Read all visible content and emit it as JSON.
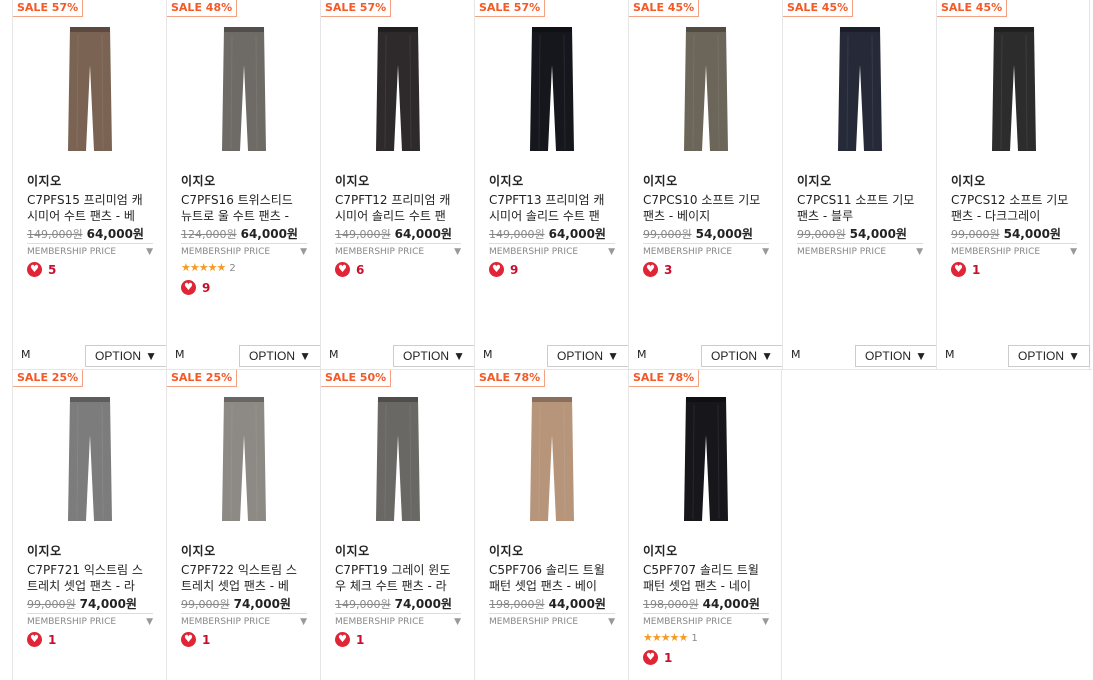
{
  "products_row1": [
    {
      "sale": "SALE 57%",
      "brand": "이지오",
      "name": "C7PFS15 프리미엄 캐시미어 수트 팬츠 - 베",
      "orig": "149,000원",
      "price": "64,000원",
      "membership": "MEMBERSHIP PRICE",
      "likes": "5",
      "stars": "",
      "star_count": "",
      "size": "M",
      "option": "OPTION",
      "color": "#7a6352"
    },
    {
      "sale": "SALE 48%",
      "brand": "이지오",
      "name": "C7PFS16 트위스티드 뉴트로 울 수트 팬츠 -",
      "orig": "124,000원",
      "price": "64,000원",
      "membership": "MEMBERSHIP PRICE",
      "likes": "9",
      "stars": "★★★★★",
      "star_count": "2",
      "size": "M",
      "option": "OPTION",
      "color": "#6e6a66"
    },
    {
      "sale": "SALE 57%",
      "brand": "이지오",
      "name": "C7PFT12 프리미엄 캐시미어 솔리드 수트 팬",
      "orig": "149,000원",
      "price": "64,000원",
      "membership": "MEMBERSHIP PRICE",
      "likes": "6",
      "stars": "",
      "star_count": "",
      "size": "M",
      "option": "OPTION",
      "color": "#2e2a2b"
    },
    {
      "sale": "SALE 57%",
      "brand": "이지오",
      "name": "C7PFT13 프리미엄 캐시미어 솔리드 수트 팬",
      "orig": "149,000원",
      "price": "64,000원",
      "membership": "MEMBERSHIP PRICE",
      "likes": "9",
      "stars": "",
      "star_count": "",
      "size": "M",
      "option": "OPTION",
      "color": "#15171c"
    },
    {
      "sale": "SALE 45%",
      "brand": "이지오",
      "name": "C7PCS10 소프트 기모 팬츠 - 베이지",
      "orig": "99,000원",
      "price": "54,000원",
      "membership": "MEMBERSHIP PRICE",
      "likes": "3",
      "stars": "",
      "star_count": "",
      "size": "M",
      "option": "OPTION",
      "color": "#6c6559"
    },
    {
      "sale": "SALE 45%",
      "brand": "이지오",
      "name": "C7PCS11 소프트 기모 팬츠 - 블루",
      "orig": "99,000원",
      "price": "54,000원",
      "membership": "MEMBERSHIP PRICE",
      "likes": "",
      "stars": "",
      "star_count": "",
      "size": "M",
      "option": "OPTION",
      "color": "#262a38"
    },
    {
      "sale": "SALE 45%",
      "brand": "이지오",
      "name": "C7PCS12 소프트 기모 팬츠 - 다크그레이",
      "orig": "99,000원",
      "price": "54,000원",
      "membership": "MEMBERSHIP PRICE",
      "likes": "1",
      "stars": "",
      "star_count": "",
      "size": "M",
      "option": "OPTION",
      "color": "#2c2c2c"
    }
  ],
  "products_row2": [
    {
      "sale": "SALE 25%",
      "brand": "이지오",
      "name": "C7PF721 익스트림 스트레치 셋업 팬츠 - 라",
      "orig": "99,000원",
      "price": "74,000원",
      "membership": "MEMBERSHIP PRICE",
      "likes": "1",
      "stars": "",
      "star_count": "",
      "color": "#7c7c7c"
    },
    {
      "sale": "SALE 25%",
      "brand": "이지오",
      "name": "C7PF722 익스트림 스트레치 셋업 팬츠 - 베",
      "orig": "99,000원",
      "price": "74,000원",
      "membership": "MEMBERSHIP PRICE",
      "likes": "1",
      "stars": "",
      "star_count": "",
      "color": "#8d8984"
    },
    {
      "sale": "SALE 50%",
      "brand": "이지오",
      "name": "C7PFT19 그레이 윈도우 체크 수트 팬츠 - 라",
      "orig": "149,000원",
      "price": "74,000원",
      "membership": "MEMBERSHIP PRICE",
      "likes": "1",
      "stars": "",
      "star_count": "",
      "color": "#6a6865"
    },
    {
      "sale": "SALE 78%",
      "brand": "이지오",
      "name": "C5PF706 솔리드 트윌 패턴 셋업 팬츠 - 베이",
      "orig": "198,000원",
      "price": "44,000원",
      "membership": "MEMBERSHIP PRICE",
      "likes": "",
      "stars": "",
      "star_count": "",
      "color": "#b7957b"
    },
    {
      "sale": "SALE 78%",
      "brand": "이지오",
      "name": "C5PF707 솔리드 트윌 패턴 셋업 팬츠 - 네이",
      "orig": "198,000원",
      "price": "44,000원",
      "membership": "MEMBERSHIP PRICE",
      "likes": "1",
      "stars": "★★★★★",
      "star_count": "1",
      "color": "#16161b"
    }
  ]
}
